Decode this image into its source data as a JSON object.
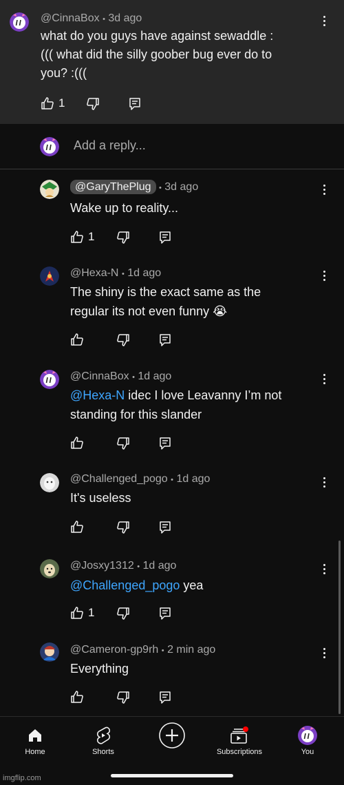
{
  "parent_comment": {
    "author": "@CinnaBox",
    "age": "3d ago",
    "lines": [
      "what do you guys have against sewaddle :",
      "((( what did the silly goober bug ever do to",
      "you? :((("
    ],
    "likes": "1"
  },
  "reply_box": {
    "placeholder": "Add a reply..."
  },
  "replies": [
    {
      "author": "@GaryThePlug",
      "age": "3d ago",
      "line1": "Wake up to reality...",
      "likes": "1"
    },
    {
      "author": "@Hexa-N",
      "age": "1d ago",
      "line1": "The shiny is the exact same as the",
      "line2": "regular its not even funny 😭",
      "likes": ""
    },
    {
      "author": "@CinnaBox",
      "age": "1d ago",
      "mention": "@Hexa-N",
      "line1_rest": " idec I love Leavanny I’m not",
      "line2": "standing for this slander",
      "likes": ""
    },
    {
      "author": "@Challenged_pogo",
      "age": "1d ago",
      "line1": "It's useless",
      "likes": ""
    },
    {
      "author": "@Josxy1312",
      "age": "1d ago",
      "mention": "@Challenged_pogo",
      "line1_rest": " yea",
      "likes": "1"
    },
    {
      "author": "@Cameron-gp9rh",
      "age": "2 min ago",
      "line1": "Everything",
      "likes": ""
    }
  ],
  "separator": "•",
  "nav": {
    "home": "Home",
    "shorts": "Shorts",
    "create_icon": "plus-circle-icon",
    "subscriptions": "Subscriptions",
    "you": "You"
  },
  "watermark": "imgflip.com",
  "colors": {
    "background": "#0f0f0f",
    "parent_bg": "#272727",
    "mention": "#3ea6ff",
    "notification": "#ff0000",
    "avatar_purple": "#7b3fc4"
  }
}
